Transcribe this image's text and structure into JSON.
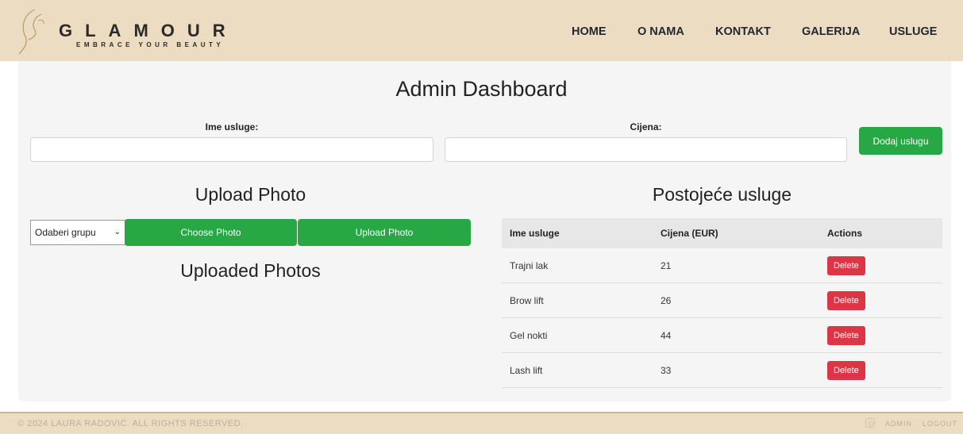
{
  "header": {
    "logo_word": "GLAMOUR",
    "logo_tagline": "EMBRACE YOUR BEAUTY",
    "nav": [
      "HOME",
      "O NAMA",
      "KONTAKT",
      "GALERIJA",
      "USLUGE"
    ]
  },
  "dashboard": {
    "title": "Admin Dashboard",
    "form": {
      "name_label": "Ime usluge:",
      "name_value": "",
      "price_label": "Cijena:",
      "price_value": "",
      "add_button": "Dodaj uslugu"
    },
    "upload": {
      "title": "Upload Photo",
      "group_select": "Odaberi grupu",
      "choose_button": "Choose Photo",
      "upload_button": "Upload Photo",
      "uploaded_title": "Uploaded Photos"
    },
    "services": {
      "title": "Postojeće usluge",
      "columns": [
        "Ime usluge",
        "Cijena (EUR)",
        "Actions"
      ],
      "rows": [
        {
          "name": "Trajni lak",
          "price": "21",
          "action": "Delete"
        },
        {
          "name": "Brow lift",
          "price": "26",
          "action": "Delete"
        },
        {
          "name": "Gel nokti",
          "price": "44",
          "action": "Delete"
        },
        {
          "name": "Lash lift",
          "price": "33",
          "action": "Delete"
        }
      ]
    }
  },
  "footer": {
    "copyright": "© 2024 LAURA RADOVIĆ. ALL RIGHTS RESERVED.",
    "instagram_icon": "instagram-icon",
    "admin_link": "ADMIN",
    "logout_link": "LOGOUT"
  },
  "colors": {
    "header_bg": "#ecdcc1",
    "accent_green": "#28a745",
    "danger_red": "#dc3545"
  }
}
